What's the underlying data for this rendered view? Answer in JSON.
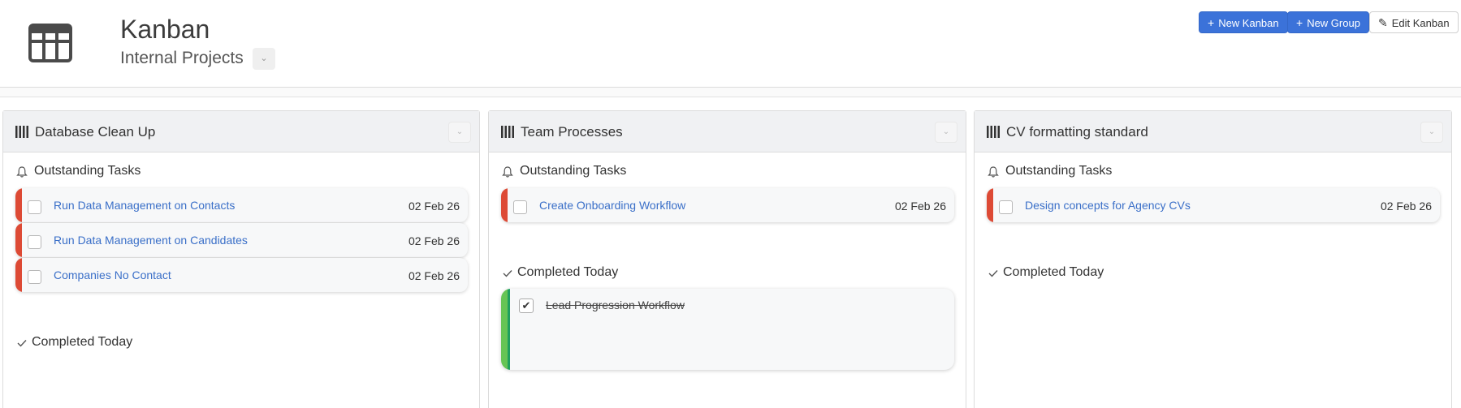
{
  "header": {
    "title": "Kanban",
    "subtitle": "Internal Projects",
    "caret_icon": "chevron-down-icon",
    "app_icon": "table-icon"
  },
  "toolbar": {
    "new_kanban_label": "New Kanban",
    "new_group_label": "New Group",
    "edit_kanban_label": "Edit Kanban",
    "accent_color": "#3b72d9"
  },
  "columns": [
    {
      "title": "Database Clean Up",
      "outstanding_label": "Outstanding Tasks",
      "completed_label": "Completed Today",
      "tasks": [
        {
          "name": "Run Data Management on Contacts",
          "date": "02 Feb 26"
        },
        {
          "name": "Run Data Management on Candidates",
          "date": "02 Feb 26"
        },
        {
          "name": "Companies No Contact",
          "date": "02 Feb 26"
        }
      ],
      "completed": []
    },
    {
      "title": "Team Processes",
      "outstanding_label": "Outstanding Tasks",
      "completed_label": "Completed Today",
      "tasks": [
        {
          "name": "Create Onboarding Workflow",
          "date": "02 Feb 26"
        }
      ],
      "completed": [
        {
          "name": "Lead Progression Workflow",
          "checkmark": "✔"
        }
      ]
    },
    {
      "title": "CV formatting standard",
      "outstanding_label": "Outstanding Tasks",
      "completed_label": "Completed Today",
      "tasks": [
        {
          "name": "Design concepts for Agency CVs",
          "date": "02 Feb 26"
        }
      ],
      "completed": []
    }
  ],
  "colors": {
    "overdue_stripe": "#dd4a35",
    "done_stripe": "#66c455",
    "link": "#3a6fc8"
  }
}
